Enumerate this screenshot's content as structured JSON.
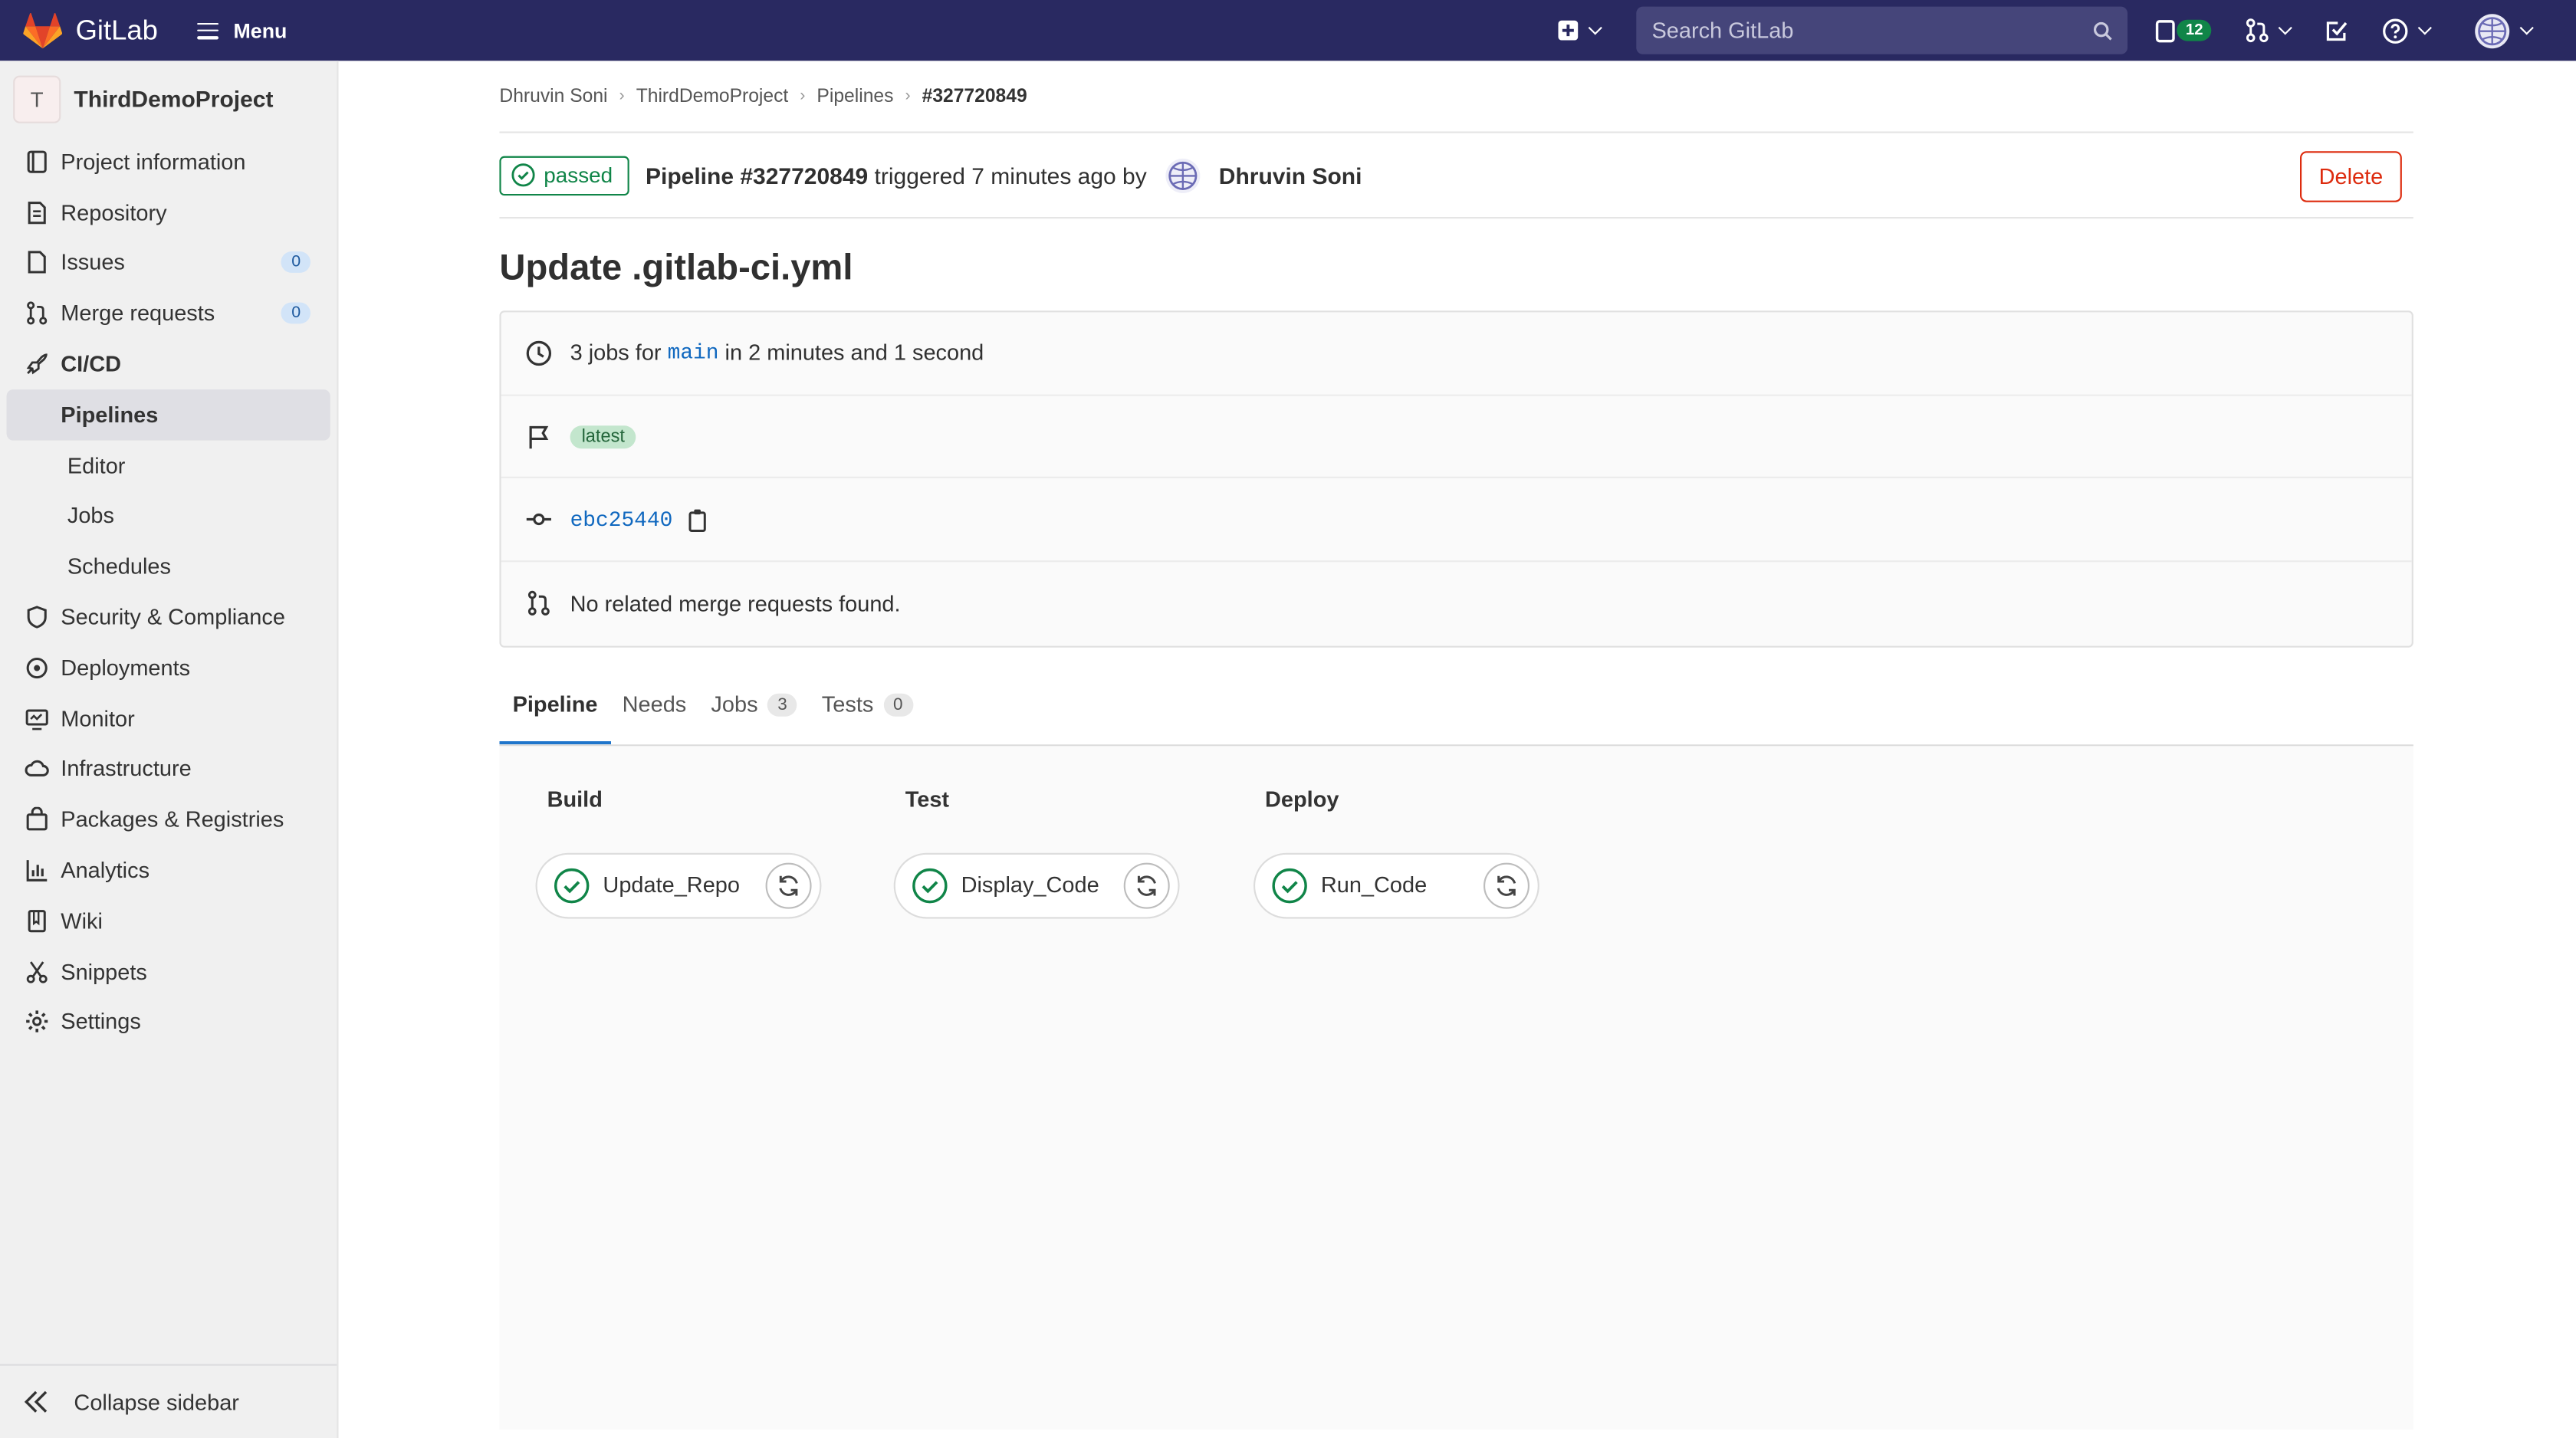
{
  "topbar": {
    "app_name": "GitLab",
    "menu_label": "Menu",
    "search_placeholder": "Search GitLab",
    "issues_count": "12"
  },
  "sidebar": {
    "project_initial": "T",
    "project_name": "ThirdDemoProject",
    "items": [
      {
        "label": "Project information",
        "icon": "info-icon"
      },
      {
        "label": "Repository",
        "icon": "repository-icon"
      },
      {
        "label": "Issues",
        "icon": "issues-icon",
        "count": "0"
      },
      {
        "label": "Merge requests",
        "icon": "merge-request-icon",
        "count": "0"
      },
      {
        "label": "CI/CD",
        "icon": "rocket-icon"
      },
      {
        "label": "Security & Compliance",
        "icon": "shield-icon"
      },
      {
        "label": "Deployments",
        "icon": "deployments-icon"
      },
      {
        "label": "Monitor",
        "icon": "monitor-icon"
      },
      {
        "label": "Infrastructure",
        "icon": "cloud-icon"
      },
      {
        "label": "Packages & Registries",
        "icon": "package-icon"
      },
      {
        "label": "Analytics",
        "icon": "chart-icon"
      },
      {
        "label": "Wiki",
        "icon": "book-icon"
      },
      {
        "label": "Snippets",
        "icon": "scissors-icon"
      },
      {
        "label": "Settings",
        "icon": "gear-icon"
      }
    ],
    "cicd_sub": [
      "Pipelines",
      "Editor",
      "Jobs",
      "Schedules"
    ],
    "collapse_label": "Collapse sidebar"
  },
  "breadcrumb": [
    "Dhruvin Soni",
    "ThirdDemoProject",
    "Pipelines",
    "#327720849"
  ],
  "pipeline": {
    "status": "passed",
    "title_prefix": "Pipeline #327720849",
    "triggered_text": " triggered 7 minutes ago by ",
    "user": "Dhruvin Soni",
    "delete_label": "Delete",
    "commit_title": "Update .gitlab-ci.yml",
    "jobs_prefix": "3 jobs for ",
    "branch": "main",
    "duration": " in 2 minutes and 1 second",
    "tag": "latest",
    "sha": "ebc25440",
    "mr_text": "No related merge requests found."
  },
  "tabs": [
    {
      "label": "Pipeline",
      "count": ""
    },
    {
      "label": "Needs",
      "count": ""
    },
    {
      "label": "Jobs",
      "count": "3"
    },
    {
      "label": "Tests",
      "count": "0"
    }
  ],
  "stages": [
    {
      "name": "Build",
      "job": "Update_Repo",
      "status": "success"
    },
    {
      "name": "Test",
      "job": "Display_Code",
      "status": "success"
    },
    {
      "name": "Deploy",
      "job": "Run_Code",
      "status": "success"
    }
  ],
  "colors": {
    "topbar": "#292961",
    "success": "#108548",
    "link": "#1068bf",
    "danger": "#dd2b0e",
    "active_tab": "#1f75cb"
  }
}
